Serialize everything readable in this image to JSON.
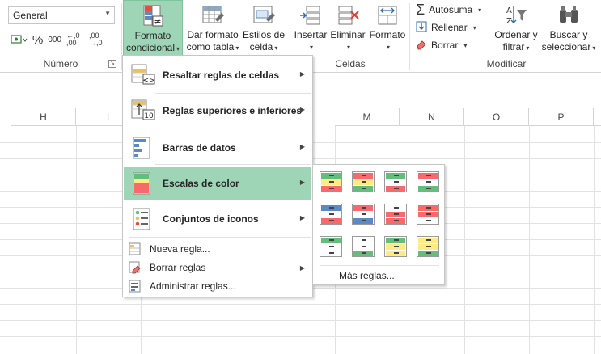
{
  "ribbon": {
    "number_group": {
      "format_value": "General",
      "percent": "%",
      "thousands": "000",
      "inc_decimals": "←,0 ,00",
      "dec_decimals": ",00 →,0",
      "label": "Número"
    },
    "styles_group": {
      "conditional_format": {
        "line1": "Formato",
        "line2": "condicional"
      },
      "format_as_table": {
        "line1": "Dar formato",
        "line2": "como tabla"
      },
      "cell_styles": {
        "line1": "Estilos de",
        "line2": "celda"
      }
    },
    "cells_group": {
      "insert": "Insertar",
      "delete": "Eliminar",
      "format": "Formato",
      "label": "Celdas"
    },
    "modify_group": {
      "autosum": "Autosuma",
      "fill": "Rellenar",
      "clear": "Borrar",
      "sort_filter": {
        "line1": "Ordenar y",
        "line2": "filtrar"
      },
      "find_select": {
        "line1": "Buscar y",
        "line2": "seleccionar"
      },
      "label": "Modificar"
    }
  },
  "columns": [
    "H",
    "I",
    "M",
    "N",
    "O",
    "P"
  ],
  "menu": {
    "items": [
      {
        "label": "Resaltar reglas de celdas",
        "key": "R"
      },
      {
        "label": "Reglas superiores e inferiores",
        "key": "e"
      },
      {
        "label": "Barras de datos",
        "key": "d"
      },
      {
        "label": "Escalas de color",
        "key": "s"
      },
      {
        "label": "Conjuntos de iconos",
        "key": "C"
      }
    ],
    "small_items": [
      {
        "label": "Nueva regla...",
        "key": "N"
      },
      {
        "label": "Borrar reglas",
        "key": "B"
      },
      {
        "label": "Administrar reglas...",
        "key": "A"
      }
    ]
  },
  "submenu": {
    "more_rules": "Más reglas...",
    "colors": {
      "green": "#63be7b",
      "yellow": "#ffeb84",
      "red": "#f8696b",
      "blue": "#5a8ac6",
      "white": "#fcfcff"
    }
  },
  "accent": "#9fd5b7"
}
